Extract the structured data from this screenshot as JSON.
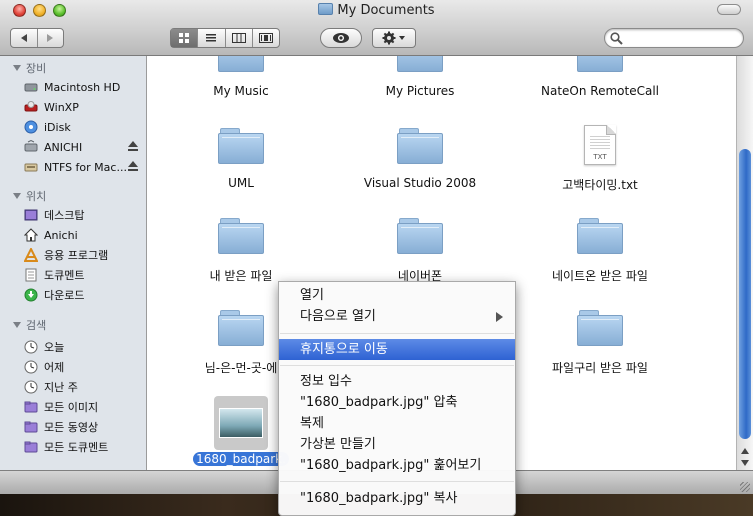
{
  "window": {
    "title": "My Documents"
  },
  "search": {
    "placeholder": ""
  },
  "sidebar": {
    "devices_header": "장비",
    "devices": [
      {
        "label": "Macintosh HD",
        "icon": "hard-drive-icon"
      },
      {
        "label": "WinXP",
        "icon": "windows-drive-icon"
      },
      {
        "label": "iDisk",
        "icon": "idisk-icon"
      },
      {
        "label": "ANICHI",
        "icon": "network-drive-icon"
      },
      {
        "label": "NTFS for Mac...",
        "icon": "external-drive-icon"
      }
    ],
    "places_header": "위치",
    "places": [
      {
        "label": "데스크탑",
        "icon": "desktop-icon"
      },
      {
        "label": "Anichi",
        "icon": "home-icon"
      },
      {
        "label": "응용 프로그램",
        "icon": "applications-icon"
      },
      {
        "label": "도큐멘트",
        "icon": "documents-icon"
      },
      {
        "label": "다운로드",
        "icon": "downloads-icon"
      }
    ],
    "search_header": "검색",
    "searches": [
      {
        "label": "오늘",
        "icon": "clock-icon"
      },
      {
        "label": "어제",
        "icon": "clock-icon"
      },
      {
        "label": "지난 주",
        "icon": "clock-icon"
      },
      {
        "label": "모든 이미지",
        "icon": "smart-folder-icon"
      },
      {
        "label": "모든 동영상",
        "icon": "smart-folder-icon"
      },
      {
        "label": "모든 도큐멘트",
        "icon": "smart-folder-icon"
      }
    ]
  },
  "files": [
    {
      "name": "My Music",
      "type": "folder"
    },
    {
      "name": "My Pictures",
      "type": "folder"
    },
    {
      "name": "NateOn RemoteCall",
      "type": "folder"
    },
    {
      "name": "UML",
      "type": "folder"
    },
    {
      "name": "Visual Studio 2008",
      "type": "folder"
    },
    {
      "name": "고백타이밍.txt",
      "type": "text",
      "ext": "TXT"
    },
    {
      "name": "내 받은 파일",
      "type": "folder"
    },
    {
      "name": "네이버폰",
      "type": "folder"
    },
    {
      "name": "네이트온 받은 파일",
      "type": "folder"
    },
    {
      "name": "님-은-먼-곳-에",
      "type": "folder"
    },
    {
      "name": "파일구리 받은 파일",
      "type": "folder"
    },
    {
      "name": "1680_badpark.",
      "type": "image",
      "selected": true
    }
  ],
  "context_menu": {
    "items": [
      "열기",
      "다음으로 열기",
      "휴지통으로 이동",
      "정보 입수",
      "\"1680_badpark.jpg\" 압축",
      "복제",
      "가상본 만들기",
      "\"1680_badpark.jpg\" 훑어보기",
      "\"1680_badpark.jpg\" 복사"
    ],
    "highlighted_index": 2
  },
  "colors": {
    "selection": "#3875d7",
    "sidebar_bg": "#dfe4ea",
    "folder_blue": "#9fc3e7"
  }
}
